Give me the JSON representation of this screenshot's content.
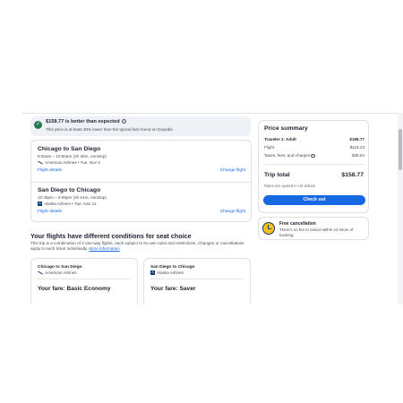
{
  "banner": {
    "title": "$158.77 is better than expected",
    "subtitle": "This price is at least 38% lower than the typical fare found on Expedia",
    "info_icon": "info-icon"
  },
  "flights": [
    {
      "route": "Chicago to San Diego",
      "times": "6:20am – 10:50am (4h 30m, nonstop)",
      "airline": "American Airlines • Tue, Nov 4",
      "details_label": "Flight details",
      "change_label": "Change flight"
    },
    {
      "route": "San Diego to Chicago",
      "times": "12:45pm – 6:59pm (4h 14m, nonstop)",
      "airline": "Alaska Airlines • Tue, Nov 11",
      "details_label": "Flight details",
      "change_label": "Change flight"
    }
  ],
  "conditions": {
    "title": "Your flights have different conditions for seat choice",
    "text": "This trip is a combination of 2 one-way flights, each subject to its own rules and restrictions. Changes or cancellations apply to each ticket individually.",
    "more_link": "More information"
  },
  "fares": [
    {
      "route": "Chicago to San Diego",
      "airline": "American Airlines",
      "fare": "Your fare: Basic Economy"
    },
    {
      "route": "San Diego to Chicago",
      "airline": "Alaska Airlines",
      "fare": "Your fare: Saver"
    }
  ],
  "price_summary": {
    "title": "Price summary",
    "traveler_label": "Traveler 1: Adult",
    "traveler_value": "$158.77",
    "flight_label": "Flight",
    "flight_value": "$119.23",
    "taxes_label": "Taxes, fees, and charges",
    "taxes_value": "$39.54",
    "total_label": "Trip total",
    "total_value": "$158.77",
    "rates_note": "Rates are quoted in US dollars",
    "checkout_label": "Check out"
  },
  "cancellation": {
    "title": "Free cancellation",
    "text": "There's no fee to cancel within 24 hours of booking."
  },
  "colors": {
    "accent": "#1668e3",
    "deal_green": "#227950",
    "banner_bg": "#eef2f6"
  }
}
